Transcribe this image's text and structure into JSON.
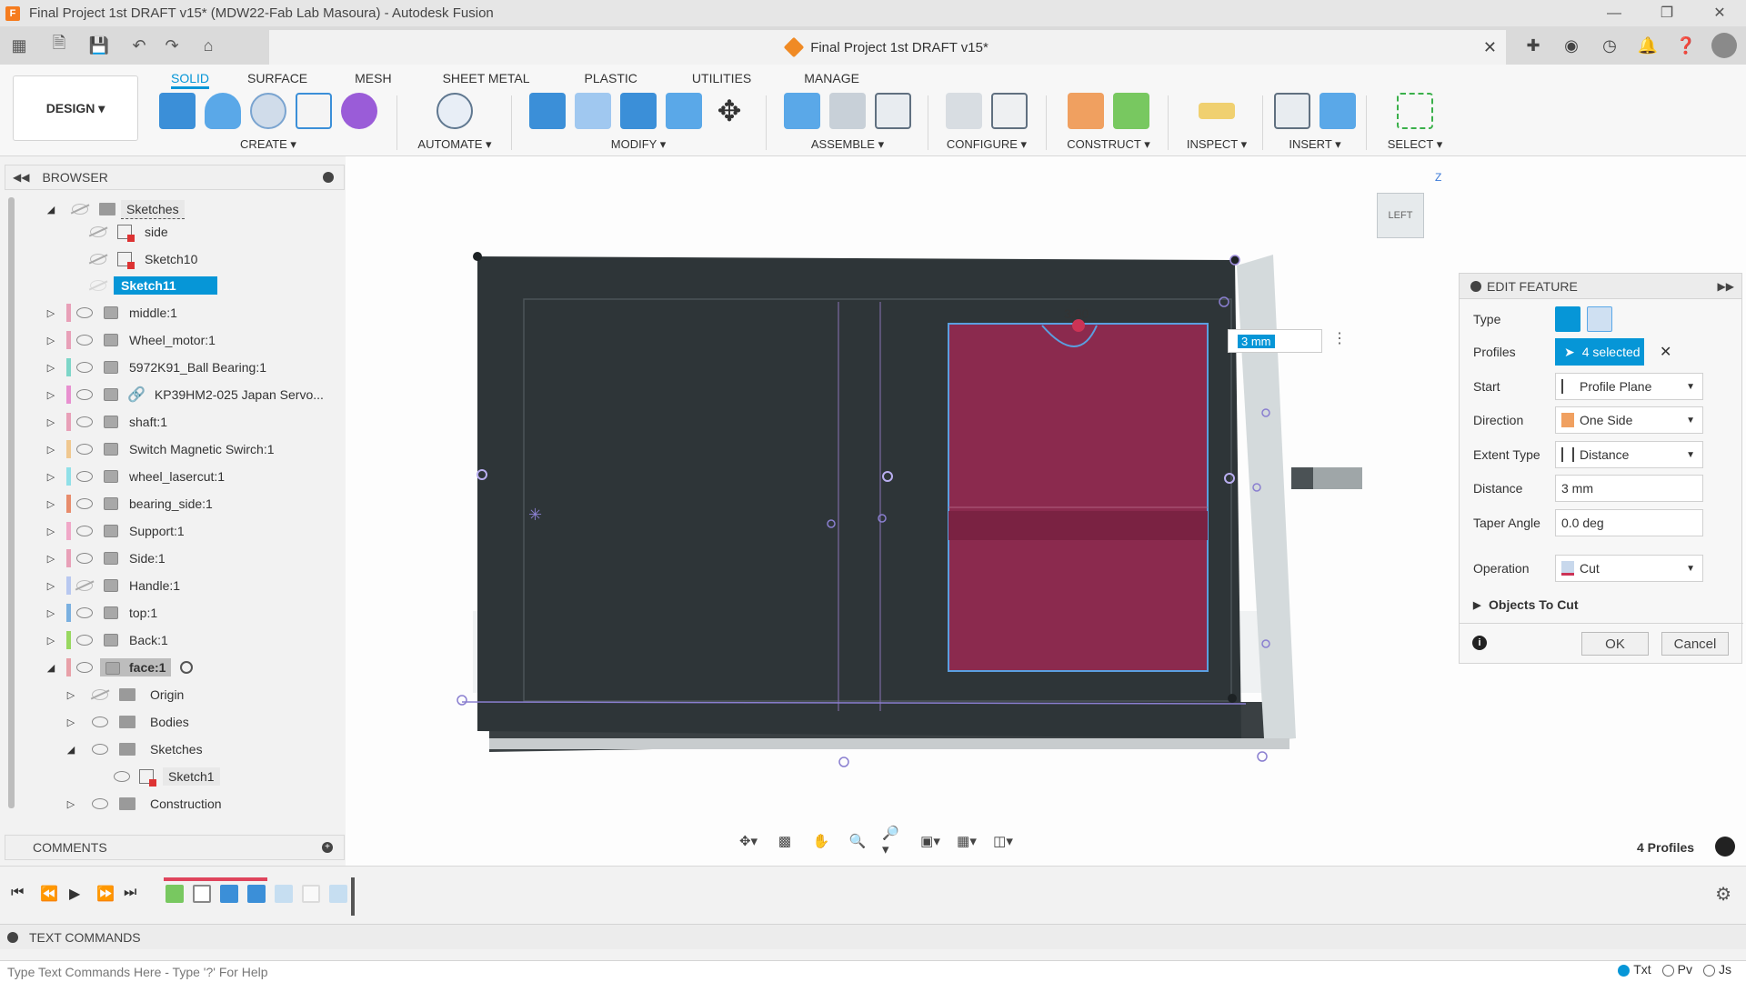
{
  "window": {
    "title": "Final Project 1st DRAFT v15* (MDW22-Fab Lab Masoura) - Autodesk Fusion",
    "app_icon_letter": "F"
  },
  "document": {
    "tab_title": "Final Project 1st DRAFT v15*"
  },
  "ribbon": {
    "workspace": "DESIGN",
    "tabs": [
      "SOLID",
      "SURFACE",
      "MESH",
      "SHEET METAL",
      "PLASTIC",
      "UTILITIES",
      "MANAGE"
    ],
    "active_tab": "SOLID",
    "groups": {
      "create": "CREATE",
      "automate": "AUTOMATE",
      "modify": "MODIFY",
      "assemble": "ASSEMBLE",
      "configure": "CONFIGURE",
      "construct": "CONSTRUCT",
      "inspect": "INSPECT",
      "insert": "INSERT",
      "select": "SELECT"
    }
  },
  "browser": {
    "title": "BROWSER",
    "items": [
      {
        "label": "Sketches",
        "type": "folder",
        "expanded": true
      },
      {
        "label": "side",
        "type": "sketch"
      },
      {
        "label": "Sketch10",
        "type": "sketch"
      },
      {
        "label": "Sketch11",
        "type": "sketch",
        "selected": true
      },
      {
        "label": "middle:1",
        "type": "component",
        "color": "#e8a0b8"
      },
      {
        "label": "Wheel_motor:1",
        "type": "component",
        "color": "#e8a0b8"
      },
      {
        "label": "5972K91_Ball Bearing:1",
        "type": "component",
        "color": "#7dd6c8"
      },
      {
        "label": "KP39HM2-025 Japan Servo...",
        "type": "component-linked",
        "color": "#e890d0"
      },
      {
        "label": "shaft:1",
        "type": "component",
        "color": "#e8a0b8"
      },
      {
        "label": "Switch Magnetic Swirch:1",
        "type": "component",
        "color": "#f0c890"
      },
      {
        "label": "wheel_lasercut:1",
        "type": "component",
        "color": "#90e0e8"
      },
      {
        "label": "bearing_side:1",
        "type": "component",
        "color": "#e88c6c"
      },
      {
        "label": "Support:1",
        "type": "component",
        "color": "#f0a8c8"
      },
      {
        "label": "Side:1",
        "type": "component",
        "color": "#e8a0b8"
      },
      {
        "label": "Handle:1",
        "type": "component",
        "color": "#b8c8f0"
      },
      {
        "label": "top:1",
        "type": "component",
        "color": "#7ab0e0"
      },
      {
        "label": "Back:1",
        "type": "component",
        "color": "#98d860"
      },
      {
        "label": "face:1",
        "type": "component",
        "color": "#e8a0a8",
        "expanded": true,
        "active": true
      },
      {
        "label": "Origin",
        "type": "folder"
      },
      {
        "label": "Bodies",
        "type": "folder"
      },
      {
        "label": "Sketches",
        "type": "folder",
        "expanded": true
      },
      {
        "label": "Sketch1",
        "type": "sketch"
      },
      {
        "label": "Construction",
        "type": "folder"
      }
    ]
  },
  "comments": {
    "title": "COMMENTS"
  },
  "viewcube": {
    "face": "LEFT",
    "axis_z": "Z"
  },
  "viewport": {
    "dimension_text": "3.00",
    "inline_input": "3 mm",
    "profiles_count": "4 Profiles"
  },
  "edit_feature": {
    "title": "EDIT FEATURE",
    "type_label": "Type",
    "profiles_label": "Profiles",
    "profiles_value": "4 selected",
    "start_label": "Start",
    "start_value": "Profile Plane",
    "direction_label": "Direction",
    "direction_value": "One Side",
    "extent_label": "Extent Type",
    "extent_value": "Distance",
    "distance_label": "Distance",
    "distance_value": "3 mm",
    "taper_label": "Taper Angle",
    "taper_value": "0.0 deg",
    "operation_label": "Operation",
    "operation_value": "Cut",
    "objects_label": "Objects To Cut",
    "ok_label": "OK",
    "cancel_label": "Cancel"
  },
  "text_commands": {
    "title": "TEXT COMMANDS",
    "placeholder": "Type Text Commands Here - Type '?' For Help",
    "modes": [
      "Txt",
      "Pv",
      "Js"
    ],
    "active_mode": "Txt"
  },
  "colors": {
    "accent": "#0696d7",
    "cut_profile": "#8b2a4e",
    "body_dark": "#2e3538"
  }
}
